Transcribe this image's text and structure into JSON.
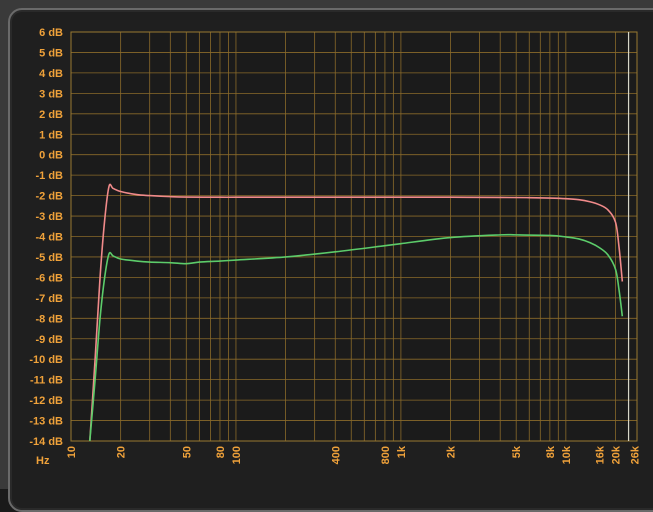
{
  "chart_data": {
    "type": "line",
    "x_unit_label": "Hz",
    "x_scale": "log",
    "xlim": [
      10,
      27000
    ],
    "ylim": [
      -14,
      6
    ],
    "y_ticks": [
      6,
      5,
      4,
      3,
      2,
      1,
      0,
      -1,
      -2,
      -3,
      -4,
      -5,
      -6,
      -7,
      -8,
      -9,
      -10,
      -11,
      -12,
      -13,
      -14
    ],
    "y_tick_labels": [
      "6 dB",
      "5 dB",
      "4 dB",
      "3 dB",
      "2 dB",
      "1 dB",
      "0 dB",
      "-1 dB",
      "-2 dB",
      "-3 dB",
      "-4 dB",
      "-5 dB",
      "-6 dB",
      "-7 dB",
      "-8 dB",
      "-9 dB",
      "-10 dB",
      "-11 dB",
      "-12 dB",
      "-13 dB",
      "-14 dB"
    ],
    "x_tick_values": [
      10,
      20,
      50,
      80,
      100,
      400,
      800,
      1000,
      2000,
      5000,
      8000,
      10000,
      16000,
      20000,
      26000
    ],
    "x_tick_labels": [
      "10",
      "20",
      "50",
      "80",
      "100",
      "400",
      "800",
      "1k",
      "2k",
      "5k",
      "8k",
      "10k",
      "16k",
      "20k",
      "26k"
    ],
    "grid": true,
    "series": [
      {
        "color": "#f08a8a",
        "x": [
          13,
          14,
          15,
          16,
          17,
          18,
          20,
          25,
          30,
          40,
          50,
          80,
          100,
          200,
          400,
          800,
          1000,
          2000,
          4000,
          6000,
          8000,
          10000,
          12000,
          14000,
          16000,
          18000,
          20000,
          21000,
          22000
        ],
        "y": [
          -14,
          -10,
          -6,
          -3.2,
          -1.55,
          -1.65,
          -1.8,
          -1.95,
          -2.0,
          -2.05,
          -2.07,
          -2.08,
          -2.08,
          -2.08,
          -2.08,
          -2.08,
          -2.08,
          -2.08,
          -2.09,
          -2.1,
          -2.12,
          -2.15,
          -2.2,
          -2.3,
          -2.45,
          -2.7,
          -3.3,
          -4.5,
          -6.2
        ]
      },
      {
        "color": "#5ccc6a",
        "x": [
          13,
          14,
          15,
          16,
          17,
          18,
          20,
          25,
          30,
          40,
          50,
          60,
          80,
          100,
          200,
          400,
          800,
          1000,
          2000,
          4000,
          5000,
          8000,
          10000,
          12000,
          14000,
          16000,
          18000,
          20000,
          21000,
          22000
        ],
        "y": [
          -14,
          -11,
          -8,
          -6,
          -4.85,
          -4.95,
          -5.1,
          -5.2,
          -5.25,
          -5.28,
          -5.33,
          -5.25,
          -5.2,
          -5.15,
          -5.0,
          -4.75,
          -4.45,
          -4.35,
          -4.05,
          -3.92,
          -3.92,
          -3.95,
          -4.02,
          -4.12,
          -4.3,
          -4.55,
          -4.9,
          -5.6,
          -6.6,
          -7.9
        ]
      }
    ],
    "cursor_line_x": 24000
  }
}
